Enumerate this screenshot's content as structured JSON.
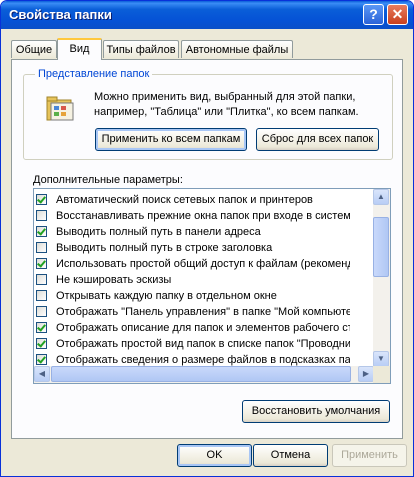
{
  "window": {
    "title": "Свойства папки",
    "help_glyph": "?",
    "close_glyph": "✕"
  },
  "tabs": [
    {
      "label": "Общие",
      "active": false
    },
    {
      "label": "Вид",
      "active": true
    },
    {
      "label": "Типы файлов",
      "active": false
    },
    {
      "label": "Автономные файлы",
      "active": false
    }
  ],
  "folder_views": {
    "label": "Представление папок",
    "description": "Можно применить вид, выбранный для этой папки, например, \"Таблица\" или \"Плитка\", ко всем папкам.",
    "apply_all_label": "Применить ко всем папкам",
    "reset_all_label": "Сброс для всех папок"
  },
  "advanced": {
    "label": "Дополнительные параметры:",
    "items": [
      {
        "text": "Автоматический поиск сетевых папок и принтеров",
        "checked": true
      },
      {
        "text": "Восстанавливать прежние окна папок при входе в систему",
        "checked": false
      },
      {
        "text": "Выводить полный путь в панели адреса",
        "checked": true
      },
      {
        "text": "Выводить полный путь в строке заголовка",
        "checked": false
      },
      {
        "text": "Использовать простой общий доступ к файлам (рекомендуется)",
        "checked": true
      },
      {
        "text": "Не кэшировать эскизы",
        "checked": false
      },
      {
        "text": "Открывать каждую папку в отдельном окне",
        "checked": false
      },
      {
        "text": "Отображать \"Панель управления\" в папке \"Мой компьютер\"",
        "checked": false
      },
      {
        "text": "Отображать описание для папок и элементов рабочего стола",
        "checked": true
      },
      {
        "text": "Отображать простой вид папок в списке папок \"Проводника\"",
        "checked": true
      },
      {
        "text": "Отображать сведения о размере файлов в подсказках папок",
        "checked": true
      }
    ]
  },
  "restore_defaults_label": "Восстановить умолчания",
  "footer": {
    "ok": "OK",
    "cancel": "Отмена",
    "apply": "Применить"
  },
  "colors": {
    "title_bar": "#0a5ed8",
    "dialog_bg": "#ece9d8",
    "group_label": "#0046d5",
    "check": "#21a121"
  }
}
